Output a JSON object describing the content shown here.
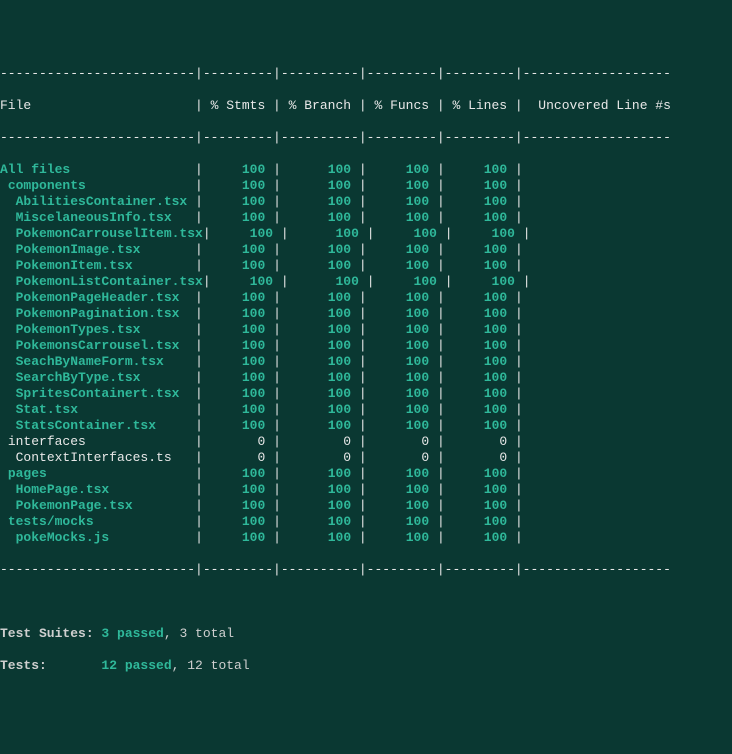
{
  "header": {
    "file": "File",
    "stmts": "% Stmts",
    "branch": "% Branch",
    "funcs": "% Funcs",
    "lines": "% Lines",
    "uncov": "Uncovered Line #s"
  },
  "rule": "-------------------------|---------|----------|---------|---------|-------------------",
  "rows": [
    {
      "indent": 0,
      "name": "All files",
      "stmts": "100",
      "branch": "100",
      "funcs": "100",
      "lines": "100",
      "g": true
    },
    {
      "indent": 1,
      "name": "components",
      "stmts": "100",
      "branch": "100",
      "funcs": "100",
      "lines": "100",
      "g": true
    },
    {
      "indent": 2,
      "name": "AbilitiesContainer.tsx",
      "stmts": "100",
      "branch": "100",
      "funcs": "100",
      "lines": "100",
      "g": true
    },
    {
      "indent": 2,
      "name": "MiscelaneousInfo.tsx",
      "stmts": "100",
      "branch": "100",
      "funcs": "100",
      "lines": "100",
      "g": true
    },
    {
      "indent": 2,
      "name": "PokemonCarrouselItem.tsx",
      "stmts": "100",
      "branch": "100",
      "funcs": "100",
      "lines": "100",
      "g": true
    },
    {
      "indent": 2,
      "name": "PokemonImage.tsx",
      "stmts": "100",
      "branch": "100",
      "funcs": "100",
      "lines": "100",
      "g": true
    },
    {
      "indent": 2,
      "name": "PokemonItem.tsx",
      "stmts": "100",
      "branch": "100",
      "funcs": "100",
      "lines": "100",
      "g": true
    },
    {
      "indent": 2,
      "name": "PokemonListContainer.tsx",
      "stmts": "100",
      "branch": "100",
      "funcs": "100",
      "lines": "100",
      "g": true
    },
    {
      "indent": 2,
      "name": "PokemonPageHeader.tsx",
      "stmts": "100",
      "branch": "100",
      "funcs": "100",
      "lines": "100",
      "g": true
    },
    {
      "indent": 2,
      "name": "PokemonPagination.tsx",
      "stmts": "100",
      "branch": "100",
      "funcs": "100",
      "lines": "100",
      "g": true
    },
    {
      "indent": 2,
      "name": "PokemonTypes.tsx",
      "stmts": "100",
      "branch": "100",
      "funcs": "100",
      "lines": "100",
      "g": true
    },
    {
      "indent": 2,
      "name": "PokemonsCarrousel.tsx",
      "stmts": "100",
      "branch": "100",
      "funcs": "100",
      "lines": "100",
      "g": true
    },
    {
      "indent": 2,
      "name": "SeachByNameForm.tsx",
      "stmts": "100",
      "branch": "100",
      "funcs": "100",
      "lines": "100",
      "g": true
    },
    {
      "indent": 2,
      "name": "SearchByType.tsx",
      "stmts": "100",
      "branch": "100",
      "funcs": "100",
      "lines": "100",
      "g": true
    },
    {
      "indent": 2,
      "name": "SpritesContainert.tsx",
      "stmts": "100",
      "branch": "100",
      "funcs": "100",
      "lines": "100",
      "g": true
    },
    {
      "indent": 2,
      "name": "Stat.tsx",
      "stmts": "100",
      "branch": "100",
      "funcs": "100",
      "lines": "100",
      "g": true
    },
    {
      "indent": 2,
      "name": "StatsContainer.tsx",
      "stmts": "100",
      "branch": "100",
      "funcs": "100",
      "lines": "100",
      "g": true
    },
    {
      "indent": 1,
      "name": "interfaces",
      "stmts": "0",
      "branch": "0",
      "funcs": "0",
      "lines": "0",
      "g": false
    },
    {
      "indent": 2,
      "name": "ContextInterfaces.ts",
      "stmts": "0",
      "branch": "0",
      "funcs": "0",
      "lines": "0",
      "g": false
    },
    {
      "indent": 1,
      "name": "pages",
      "stmts": "100",
      "branch": "100",
      "funcs": "100",
      "lines": "100",
      "g": true
    },
    {
      "indent": 2,
      "name": "HomePage.tsx",
      "stmts": "100",
      "branch": "100",
      "funcs": "100",
      "lines": "100",
      "g": true
    },
    {
      "indent": 2,
      "name": "PokemonPage.tsx",
      "stmts": "100",
      "branch": "100",
      "funcs": "100",
      "lines": "100",
      "g": true
    },
    {
      "indent": 1,
      "name": "tests/mocks",
      "stmts": "100",
      "branch": "100",
      "funcs": "100",
      "lines": "100",
      "g": true
    },
    {
      "indent": 2,
      "name": "pokeMocks.js",
      "stmts": "100",
      "branch": "100",
      "funcs": "100",
      "lines": "100",
      "g": true
    }
  ],
  "summary": {
    "suites_label": "Test Suites: ",
    "suites_pass": "3 passed",
    "suites_rest": ", 3 total",
    "tests_label": "Tests:       ",
    "tests_pass": "12 passed",
    "tests_rest": ", 12 total"
  }
}
